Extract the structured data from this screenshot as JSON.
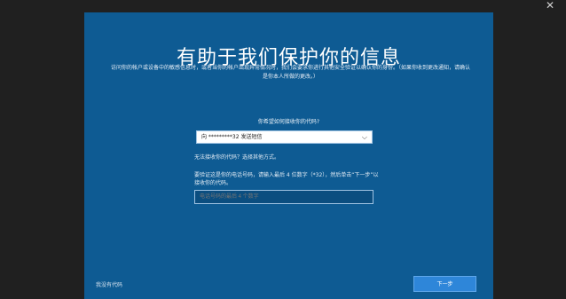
{
  "window": {
    "close_glyph": "✕"
  },
  "dialog": {
    "title": "有助于我们保护你的信息",
    "description": "访问你的帐户或设备中的敏感信息时，或者当你的帐户出现异常情况时，我们会要求你进行其他安全验证以确认你的身份。（如果你收到更改通知，请确认是你本人所做的更改。）",
    "prompt": "你希望如何接收你的代码?",
    "method_select": {
      "value": "向 *********32 发送短信",
      "chevron": "⌵"
    },
    "no_access_text": "无法接收你的代码？选择其他方式。",
    "verify_instructions": "要验证这是你的电话号码，请输入最后 4 位数字（*32），然后单击“下一步”以接收你的代码。",
    "code_input": {
      "placeholder": "电话号码的最后 4 个数字"
    },
    "use_other_link": "我没有代码",
    "next_button": "下一步"
  }
}
